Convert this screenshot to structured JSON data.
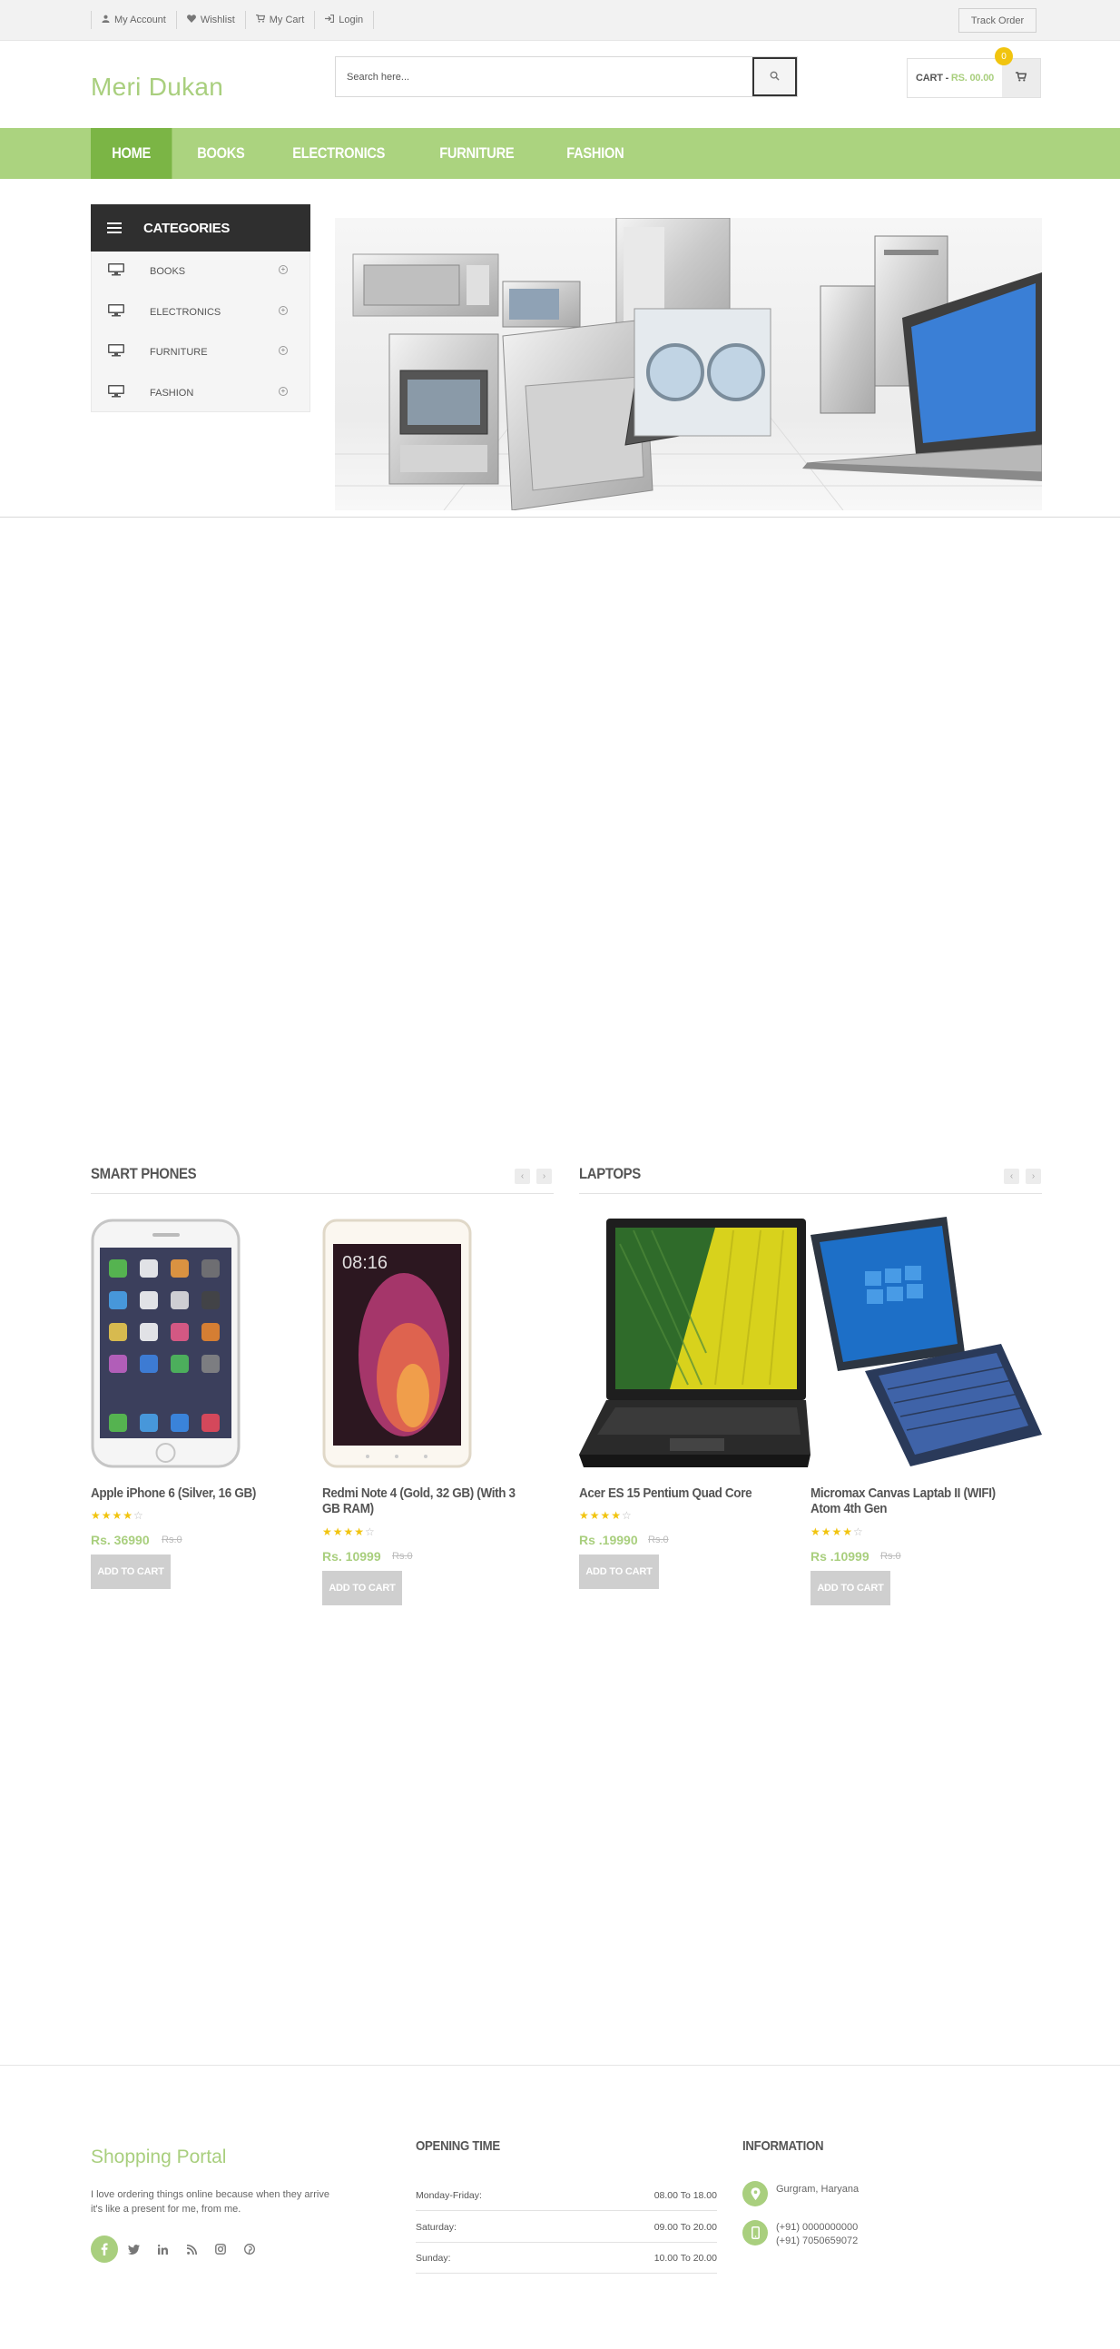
{
  "topbar": {
    "links": [
      {
        "icon": "user-icon",
        "label": "My Account"
      },
      {
        "icon": "heart-icon",
        "label": "Wishlist"
      },
      {
        "icon": "cart-icon",
        "label": "My Cart"
      },
      {
        "icon": "login-icon",
        "label": "Login"
      }
    ],
    "track_order": "Track Order"
  },
  "header": {
    "logo": "Meri Dukan",
    "search_placeholder": "Search here...",
    "cart_label": "CART -",
    "cart_amount": "RS. 00.00",
    "cart_count": "0"
  },
  "nav": {
    "items": [
      "HOME",
      "BOOKS",
      "ELECTRONICS",
      "FURNITURE",
      "FASHION"
    ],
    "active": "HOME"
  },
  "categories": {
    "title": "CATEGORIES",
    "items": [
      "BOOKS",
      "ELECTRONICS",
      "FURNITURE",
      "FASHION"
    ]
  },
  "sections": {
    "smartphones": {
      "title": "SMART PHONES",
      "products": [
        {
          "name": "Apple iPhone 6 (Silver, 16 GB)",
          "price": "Rs. 36990",
          "old_price": "Rs.0",
          "rating": 4,
          "button": "ADD TO CART"
        },
        {
          "name": "Redmi Note 4 (Gold, 32 GB) (With 3 GB RAM)",
          "price": "Rs. 10999",
          "old_price": "Rs.0",
          "rating": 4,
          "button": "ADD TO CART"
        }
      ]
    },
    "laptops": {
      "title": "LAPTOPS",
      "products": [
        {
          "name": "Acer ES 15 Pentium Quad Core",
          "price": "Rs .19990",
          "old_price": "Rs.0",
          "rating": 4,
          "button": "ADD TO CART"
        },
        {
          "name": "Micromax Canvas Laptab II (WIFI) Atom 4th Gen",
          "price": "Rs .10999",
          "old_price": "Rs.0",
          "rating": 4,
          "button": "ADD TO CART"
        }
      ]
    }
  },
  "footer": {
    "logo": "Shopping Portal",
    "description": "I love ordering things online because when they arrive it's like a present for me, from me.",
    "opening_title": "OPENING TIME",
    "hours": [
      {
        "day": "Monday-Friday:",
        "time": "08.00 To 18.00"
      },
      {
        "day": "Saturday:",
        "time": "09.00 To 20.00"
      },
      {
        "day": "Sunday:",
        "time": "10.00 To 20.00"
      }
    ],
    "info_title": "INFORMATION",
    "address": "Gurgram, Haryana",
    "phone1": "(+91) 0000000000",
    "phone2": "(+91) 7050659072"
  },
  "colors": {
    "accent": "#abd37f",
    "accent_dark": "#7bb545",
    "dark": "#2f2f2f",
    "star": "#f1c40f"
  }
}
